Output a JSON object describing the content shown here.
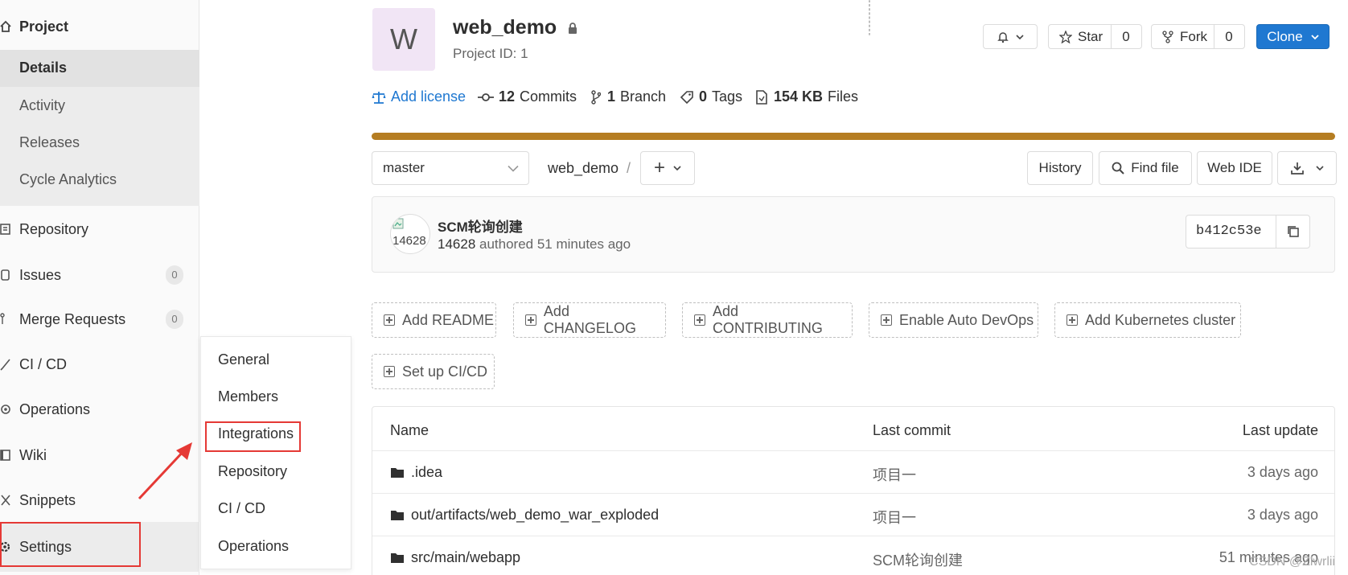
{
  "sidebar": {
    "project": "Project",
    "project_sub": [
      "Details",
      "Activity",
      "Releases",
      "Cycle Analytics"
    ],
    "items": [
      {
        "label": "Repository"
      },
      {
        "label": "Issues",
        "count": "0"
      },
      {
        "label": "Merge Requests",
        "count": "0"
      },
      {
        "label": "CI / CD"
      },
      {
        "label": "Operations"
      },
      {
        "label": "Wiki"
      },
      {
        "label": "Snippets"
      },
      {
        "label": "Settings"
      }
    ]
  },
  "flyout": {
    "items": [
      "General",
      "Members",
      "Integrations",
      "Repository",
      "CI / CD",
      "Operations"
    ]
  },
  "project": {
    "avatar_letter": "W",
    "name": "web_demo",
    "id_text": "Project ID: 1"
  },
  "actions": {
    "star_label": "Star",
    "star_count": "0",
    "fork_label": "Fork",
    "fork_count": "0",
    "clone_label": "Clone"
  },
  "stats": {
    "license": "Add license",
    "commits_num": "12",
    "commits_label": "Commits",
    "branch_num": "1",
    "branch_label": "Branch",
    "tags_num": "0",
    "tags_label": "Tags",
    "files_num": "154 KB",
    "files_label": "Files"
  },
  "toolbar": {
    "branch": "master",
    "path": "web_demo",
    "separator": "/",
    "add": "+",
    "history": "History",
    "find_file": "Find file",
    "web_ide": "Web IDE"
  },
  "commit": {
    "avatar_alt": "14628",
    "title": "SCM轮询创建",
    "author": "14628",
    "meta": "authored 51 minutes ago",
    "sha": "b412c53e"
  },
  "quick_actions": [
    "Add README",
    "Add CHANGELOG",
    "Add CONTRIBUTING",
    "Enable Auto DevOps",
    "Add Kubernetes cluster",
    "Set up CI/CD"
  ],
  "table": {
    "headers": {
      "name": "Name",
      "last_commit": "Last commit",
      "last_update": "Last update"
    },
    "rows": [
      {
        "name": ".idea",
        "commit": "项目一",
        "update": "3 days ago"
      },
      {
        "name": "out/artifacts/web_demo_war_exploded",
        "commit": "项目一",
        "update": "3 days ago"
      },
      {
        "name": "src/main/webapp",
        "commit": "SCM轮询创建",
        "update": "51 minutes ago"
      }
    ]
  },
  "watermark": "CSDN @Zlwrlii",
  "colors": {
    "accent": "#1f78d1",
    "progress": "#b57d22",
    "highlight": "#e53935"
  }
}
